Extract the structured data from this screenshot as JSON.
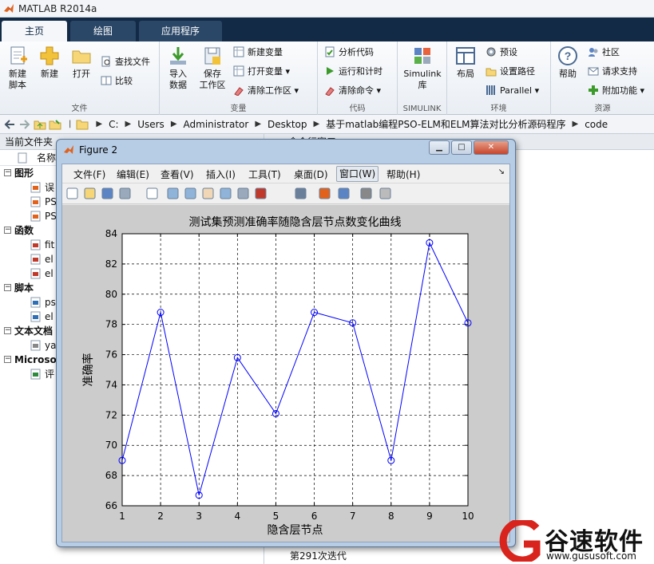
{
  "app": {
    "title": "MATLAB R2014a"
  },
  "tabs": [
    {
      "label": "主页",
      "active": true
    },
    {
      "label": "绘图",
      "active": false
    },
    {
      "label": "应用程序",
      "active": false
    }
  ],
  "ribbon": {
    "file": {
      "group_label": "文件",
      "new_script": "新建\n脚本",
      "new": "新建",
      "open": "打开",
      "find_files": "查找文件",
      "compare": "比较"
    },
    "variable": {
      "group_label": "变量",
      "import": "导入\n数据",
      "save_ws": "保存\n工作区",
      "new_var": "新建变量",
      "open_var": "打开变量",
      "clear_ws": "清除工作区"
    },
    "code": {
      "group_label": "代码",
      "analyze": "分析代码",
      "run_time": "运行和计时",
      "clear_cmd": "清除命令"
    },
    "simulink": {
      "group_label": "SIMULINK",
      "lib": "Simulink\n库"
    },
    "env": {
      "group_label": "环境",
      "layout": "布局",
      "prefs": "预设",
      "set_path": "设置路径",
      "parallel": "Parallel"
    },
    "resources": {
      "group_label": "资源",
      "help": "帮助",
      "community": "社区",
      "support": "请求支持",
      "addons": "附加功能"
    }
  },
  "address": {
    "crumbs": [
      "C:",
      "Users",
      "Administrator",
      "Desktop",
      "基于matlab编程PSO-ELM和ELM算法对比分析源码程序",
      "code"
    ]
  },
  "left_panel": {
    "title": "当前文件夹",
    "col_name": "名称",
    "tree": [
      {
        "kind": "cat",
        "label": "图形"
      },
      {
        "kind": "leaf",
        "label": "误",
        "icon": "figure-file-icon"
      },
      {
        "kind": "leaf",
        "label": "PS",
        "icon": "figure-file-icon"
      },
      {
        "kind": "leaf",
        "label": "PS",
        "icon": "figure-file-icon"
      },
      {
        "kind": "cat",
        "label": "函数"
      },
      {
        "kind": "leaf",
        "label": "fit",
        "icon": "function-file-icon"
      },
      {
        "kind": "leaf",
        "label": "el",
        "icon": "function-file-icon"
      },
      {
        "kind": "leaf",
        "label": "el",
        "icon": "function-file-icon"
      },
      {
        "kind": "cat",
        "label": "脚本"
      },
      {
        "kind": "leaf",
        "label": "ps",
        "icon": "script-file-icon"
      },
      {
        "kind": "leaf",
        "label": "el",
        "icon": "script-file-icon"
      },
      {
        "kind": "cat",
        "label": "文本文档"
      },
      {
        "kind": "leaf",
        "label": "ya",
        "icon": "text-file-icon"
      },
      {
        "kind": "cat",
        "label": "Microso"
      },
      {
        "kind": "leaf",
        "label": "评",
        "icon": "excel-file-icon"
      }
    ]
  },
  "command_window": {
    "title": "命令行窗口",
    "last_line": "第291次迭代"
  },
  "figure": {
    "window_title": "Figure 2",
    "menu": [
      "文件(F)",
      "编辑(E)",
      "查看(V)",
      "插入(I)",
      "工具(T)",
      "桌面(D)",
      "窗口(W)",
      "帮助(H)"
    ],
    "menu_selected": "窗口(W)",
    "tool_icons": [
      "new-figure-icon",
      "open-icon",
      "save-icon",
      "print-icon",
      "select-arrow-icon",
      "zoom-in-icon",
      "zoom-out-icon",
      "pan-hand-icon",
      "rotate-3d-icon",
      "data-cursor-icon",
      "brush-icon",
      "link-plot-icon",
      "colorbar-icon",
      "legend-icon",
      "hide-plot-tools-icon",
      "show-plot-tools-icon"
    ]
  },
  "chart_data": {
    "type": "line",
    "title": "测试集预测准确率随隐含层节点数变化曲线",
    "xlabel": "隐含层节点",
    "ylabel": "准确率",
    "x": [
      1,
      2,
      3,
      4,
      5,
      6,
      7,
      8,
      9,
      10
    ],
    "series": [
      {
        "values": [
          69.0,
          78.8,
          66.7,
          75.8,
          72.1,
          78.8,
          78.1,
          69.0,
          83.4,
          78.1
        ],
        "color": "#0000ff",
        "marker": "circle"
      }
    ],
    "xlim": [
      1,
      10
    ],
    "ylim": [
      66,
      84
    ],
    "xticks": [
      "1",
      "2",
      "3",
      "4",
      "5",
      "6",
      "7",
      "8",
      "9",
      "10"
    ],
    "yticks": [
      "66",
      "68",
      "70",
      "72",
      "74",
      "76",
      "78",
      "80",
      "82",
      "84"
    ],
    "grid": true
  },
  "watermark": {
    "brand": "谷速软件",
    "url": "www.gususoft.com"
  }
}
